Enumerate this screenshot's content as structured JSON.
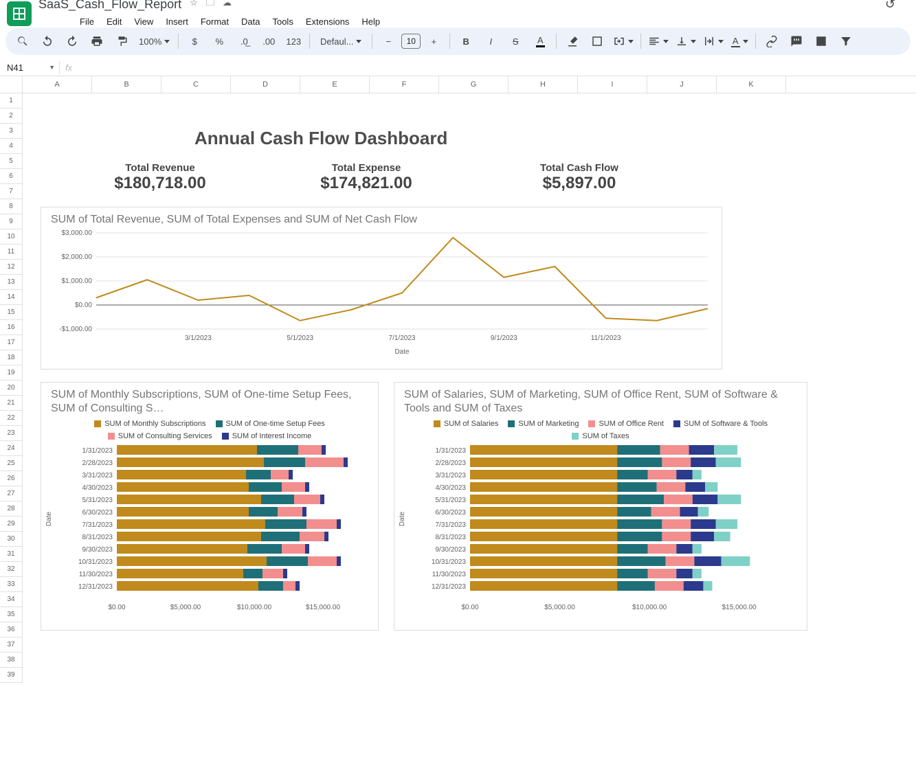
{
  "title": "SaaS_Cash_Flow_Report",
  "menus": [
    "File",
    "Edit",
    "View",
    "Insert",
    "Format",
    "Data",
    "Tools",
    "Extensions",
    "Help"
  ],
  "toolbar": {
    "zoom": "100%",
    "font": "Defaul...",
    "font_size": "10"
  },
  "namebox": "N41",
  "columns": [
    "A",
    "B",
    "C",
    "D",
    "E",
    "F",
    "G",
    "H",
    "I",
    "J",
    "K"
  ],
  "row_count": 39,
  "dashboard": {
    "title": "Annual Cash Flow Dashboard",
    "kpis": [
      {
        "label": "Total Revenue",
        "value": "$180,718.00"
      },
      {
        "label": "Total Expense",
        "value": "$174,821.00"
      },
      {
        "label": "Total Cash Flow",
        "value": "$5,897.00"
      }
    ]
  },
  "chart_data": [
    {
      "id": "line",
      "type": "line",
      "title": "SUM of Total Revenue, SUM of Total Expenses and SUM of Net Cash Flow",
      "xlabel": "Date",
      "ylabel": "",
      "y_ticks": [
        -1000,
        0,
        1000,
        2000,
        3000
      ],
      "y_tick_labels": [
        "-$1,000.00",
        "$0.00",
        "$1,000.00",
        "$2,000.00",
        "$3,000.00"
      ],
      "x_tick_labels": [
        "3/1/2023",
        "5/1/2023",
        "7/1/2023",
        "9/1/2023",
        "11/1/2023"
      ],
      "x_tick_pos": [
        2,
        4,
        6,
        8,
        10
      ],
      "points": [
        300,
        1050,
        200,
        400,
        -650,
        -200,
        500,
        2800,
        1150,
        1600,
        -550,
        -650,
        -150
      ],
      "color": "#c08a1c"
    },
    {
      "id": "revenue_bars",
      "type": "bar",
      "title": "SUM of Monthly Subscriptions, SUM of One-time Setup Fees, SUM of Consulting S…",
      "xlabel": "",
      "ylabel": "Date",
      "categories": [
        "1/31/2023",
        "2/28/2023",
        "3/31/2023",
        "4/30/2023",
        "5/31/2023",
        "6/30/2023",
        "7/31/2023",
        "8/31/2023",
        "9/30/2023",
        "10/31/2023",
        "11/30/2023",
        "12/31/2023"
      ],
      "x_ticks": [
        0,
        5000,
        10000,
        15000
      ],
      "x_tick_labels": [
        "$0.00",
        "$5,000.00",
        "$10,000.00",
        "$15,000.00"
      ],
      "legend": [
        "SUM of Monthly Subscriptions",
        "SUM of One-time Setup Fees",
        "SUM of Consulting Services",
        "SUM of Interest Income"
      ],
      "colors": [
        "#c08a1c",
        "#1f6f78",
        "#f28e8e",
        "#2b3a8c"
      ],
      "series": [
        {
          "name": "SUM of Monthly Subscriptions",
          "values": [
            10200,
            10700,
            9400,
            9600,
            10500,
            9600,
            10800,
            10500,
            9500,
            10900,
            9200,
            10300
          ]
        },
        {
          "name": "SUM of One-time Setup Fees",
          "values": [
            3000,
            3000,
            1800,
            2400,
            2400,
            2100,
            3000,
            2800,
            2500,
            3000,
            1400,
            1800
          ]
        },
        {
          "name": "SUM of Consulting Services",
          "values": [
            1700,
            2800,
            1300,
            1700,
            1900,
            1800,
            2200,
            1800,
            1700,
            2100,
            1500,
            900
          ]
        },
        {
          "name": "SUM of Interest Income",
          "values": [
            300,
            300,
            300,
            300,
            300,
            300,
            300,
            300,
            300,
            300,
            300,
            300
          ]
        }
      ]
    },
    {
      "id": "expense_bars",
      "type": "bar",
      "title": "SUM of Salaries, SUM of Marketing, SUM of Office Rent, SUM of Software & Tools and SUM of Taxes",
      "xlabel": "",
      "ylabel": "Date",
      "categories": [
        "1/31/2023",
        "2/28/2023",
        "3/31/2023",
        "4/30/2023",
        "5/31/2023",
        "6/30/2023",
        "7/31/2023",
        "8/31/2023",
        "9/30/2023",
        "10/31/2023",
        "11/30/2023",
        "12/31/2023"
      ],
      "x_ticks": [
        0,
        5000,
        10000,
        15000
      ],
      "x_tick_labels": [
        "$0.00",
        "$5,000.00",
        "$10,000.00",
        "$15,000.00"
      ],
      "legend": [
        "SUM of Salaries",
        "SUM of Marketing",
        "SUM of Office Rent",
        "SUM of Software & Tools",
        "SUM of Taxes"
      ],
      "colors": [
        "#c08a1c",
        "#1f6f78",
        "#f28e8e",
        "#2b3a8c",
        "#7fd0c7"
      ],
      "series": [
        {
          "name": "SUM of Salaries",
          "values": [
            8200,
            8200,
            8200,
            8200,
            8200,
            8200,
            8200,
            8200,
            8200,
            8200,
            8200,
            8200
          ]
        },
        {
          "name": "SUM of Marketing",
          "values": [
            2400,
            2500,
            1700,
            2200,
            2600,
            1900,
            2500,
            2500,
            1700,
            2700,
            1700,
            2100
          ]
        },
        {
          "name": "SUM of Office Rent",
          "values": [
            1600,
            1600,
            1600,
            1600,
            1600,
            1600,
            1600,
            1600,
            1600,
            1600,
            1600,
            1600
          ]
        },
        {
          "name": "SUM of Software & Tools",
          "values": [
            1400,
            1400,
            900,
            1100,
            1400,
            1000,
            1400,
            1300,
            900,
            1500,
            900,
            1100
          ]
        },
        {
          "name": "SUM of Taxes",
          "values": [
            1300,
            1400,
            500,
            700,
            1300,
            600,
            1200,
            900,
            500,
            1600,
            500,
            500
          ]
        }
      ]
    }
  ]
}
